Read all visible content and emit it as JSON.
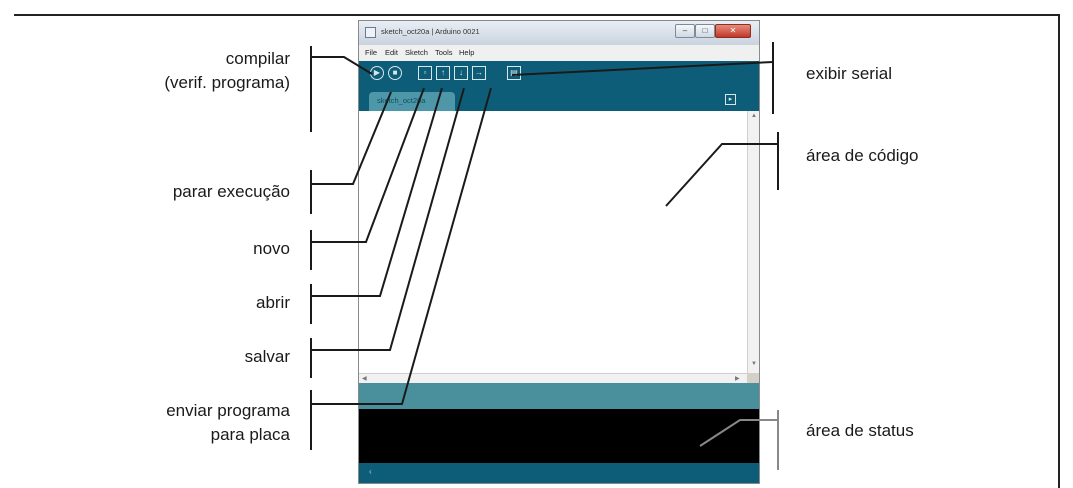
{
  "window": {
    "title": "sketch_oct20a | Arduino 0021",
    "menu": [
      "File",
      "Edit",
      "Sketch",
      "Tools",
      "Help"
    ],
    "tab_label": "sketch_oct20a"
  },
  "labels": {
    "compilar": "compilar",
    "verif": "(verif. programa)",
    "parar": "parar execução",
    "novo": "novo",
    "abrir": "abrir",
    "salvar": "salvar",
    "enviar_1": "enviar programa",
    "enviar_2": "para placa",
    "serial": "exibir serial",
    "codigo": "área de código",
    "status": "área de status"
  },
  "icons": {
    "verify": "play-icon",
    "stop": "stop-icon",
    "new": "new-file-icon",
    "open": "open-icon",
    "save": "save-icon",
    "upload": "upload-icon",
    "serial": "serial-monitor-icon"
  },
  "colors": {
    "toolbar": "#0d5d78",
    "status_bar": "#4a8f9c",
    "console": "#000000"
  }
}
